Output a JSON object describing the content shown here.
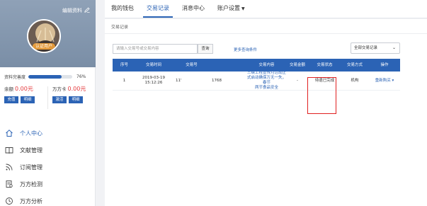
{
  "profile": {
    "edit_label": "编辑资料",
    "avatar_tag": "认证用户"
  },
  "completion": {
    "label": "资料完善度",
    "percent_text": "76%",
    "percent": 76
  },
  "wallet": {
    "balance_label": "余额",
    "balance_value": "0.00元",
    "recharge_button": "充值",
    "balance_detail_button": "明细",
    "card_label": "万方卡",
    "card_value": "0.00元",
    "activate_button": "激活",
    "card_detail_button": "明细"
  },
  "nav": {
    "items": [
      {
        "label": "个人中心",
        "icon": "home-icon"
      },
      {
        "label": "文献管理",
        "icon": "book-icon"
      },
      {
        "label": "订阅管理",
        "icon": "rss-icon"
      },
      {
        "label": "万方检测",
        "icon": "document-check-icon"
      },
      {
        "label": "万方分析",
        "icon": "clock-analysis-icon"
      }
    ]
  },
  "tabs": [
    {
      "label": "我的钱包"
    },
    {
      "label": "交易记录"
    },
    {
      "label": "消息中心"
    },
    {
      "label": "账户设置"
    }
  ],
  "breadcrumb": "交易记录",
  "search": {
    "placeholder": "请输入交易号或交易内容",
    "button": "查询",
    "more_link": "更多查询条件"
  },
  "filter": {
    "selected": "全部交易记录"
  },
  "table": {
    "headers": [
      "序号",
      "交易时间",
      "交易号",
      "交易内容",
      "交易金额",
      "交易状态",
      "交易方式",
      "操作"
    ],
    "rows": [
      {
        "index": "1",
        "time_date": "2019-03-19",
        "time_clock": "15:12:26",
        "txn_part1": "11'",
        "txn_part2": "1768",
        "content_l1": "三峡工程宣传月活动正",
        "content_l2": "式启动确保万无一失，春节",
        "content_l3": "两节食品安全",
        "amount": "-",
        "status": "待退已完成",
        "method": "机构",
        "action": "重新购买"
      }
    ]
  },
  "colors": {
    "accent": "#2b63b5",
    "highlight_border": "#e02020",
    "money": "#e4393c"
  }
}
